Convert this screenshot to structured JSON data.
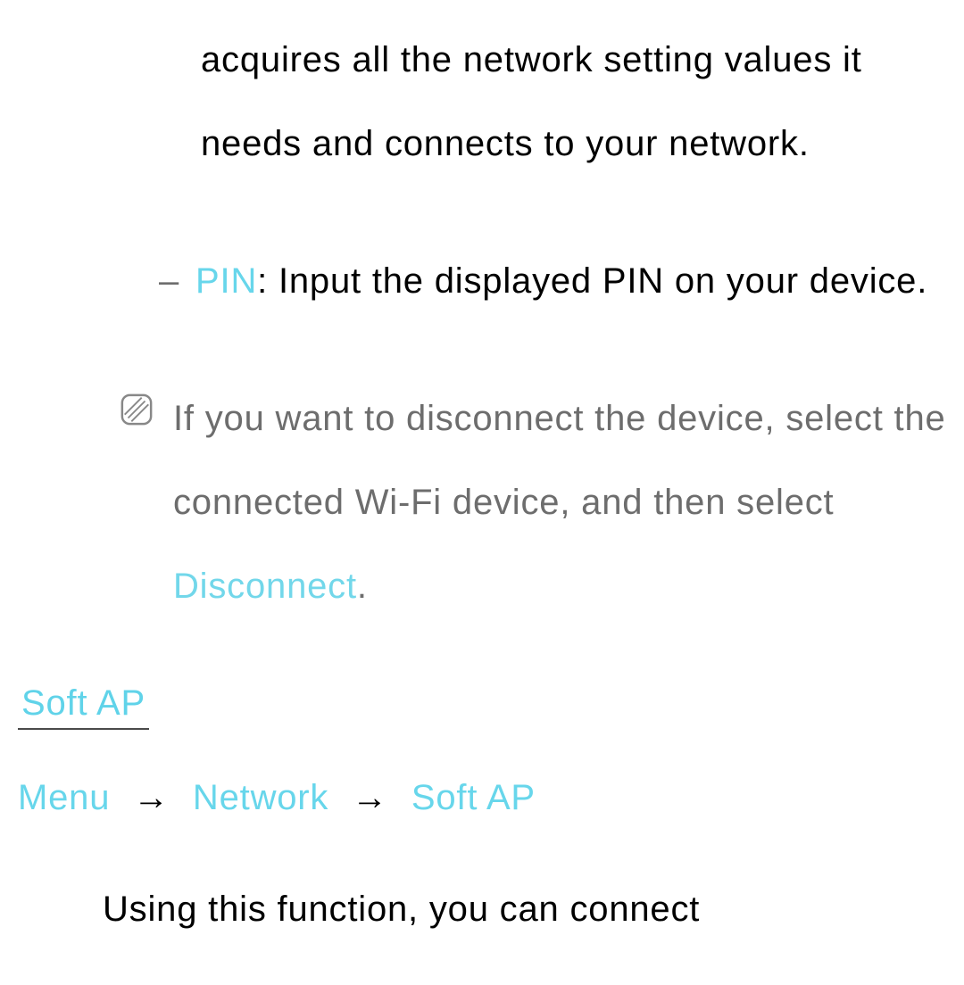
{
  "top_continuation": "acquires all the network setting values it needs and connects to your network.",
  "pin_item": {
    "label": "PIN",
    "sep": ": ",
    "text": "Input the displayed PIN on your device."
  },
  "note": {
    "pre": "If you want to disconnect the device, select the connected Wi-Fi device, and then select ",
    "action": "Disconnect",
    "post": "."
  },
  "section_heading": "Soft AP",
  "breadcrumb": {
    "a": "Menu",
    "b": "Network",
    "c": "Soft AP"
  },
  "bottom": "Using this function, you can connect"
}
